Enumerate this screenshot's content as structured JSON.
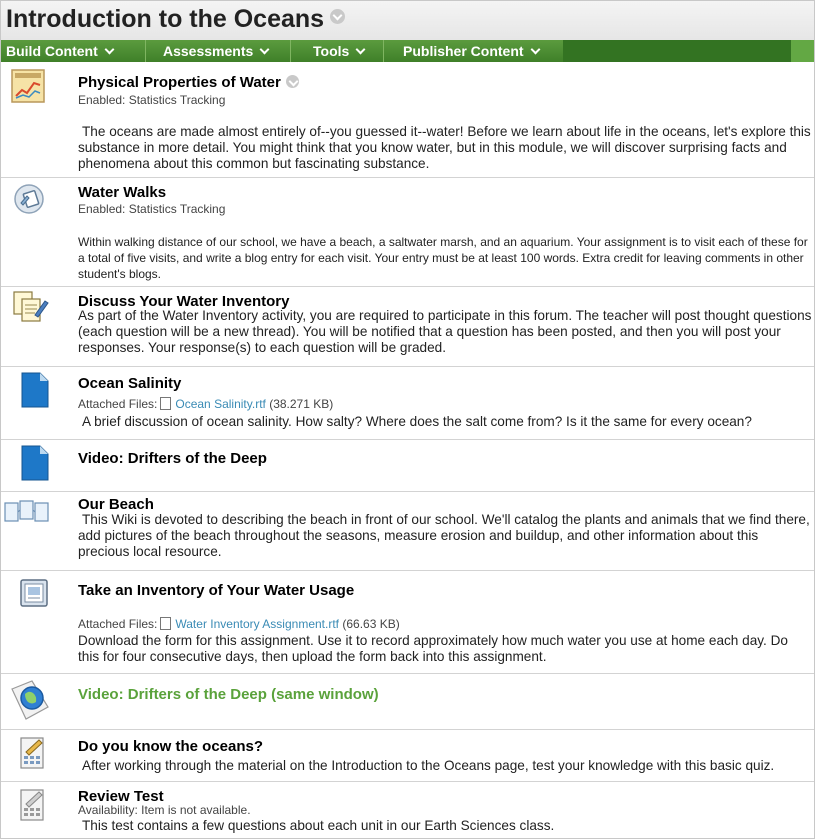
{
  "page": {
    "title": "Introduction to the Oceans"
  },
  "menu": [
    {
      "label": "Build Content"
    },
    {
      "label": "Assessments"
    },
    {
      "label": "Tools"
    },
    {
      "label": "Publisher Content"
    }
  ],
  "items": [
    {
      "icon": "chart-icon",
      "title": "Physical Properties of Water",
      "meta": "Enabled:  Statistics Tracking",
      "description": "The oceans are made almost entirely of--you guessed it--water! Before we learn about life in the oceans, let's explore this substance in more detail. You might think that you know water, but in this module, we will discover surprising facts and phenomena about this common but fascinating substance."
    },
    {
      "icon": "blog-icon",
      "title": "Water Walks",
      "meta": "Enabled:  Statistics Tracking",
      "description": "Within walking distance of our school, we have a beach, a saltwater marsh, and an aquarium. Your assignment is to visit each of these for a total of five visits, and write a blog entry for each visit. Your entry must be at least 100 words. Extra credit for leaving comments in other student's blogs."
    },
    {
      "icon": "discussion-icon",
      "title": "Discuss Your Water Inventory",
      "description": "As part of the Water Inventory activity, you are required to participate in this forum. The teacher will post thought questions (each question will be a new thread). You will be notified that a question has been posted, and then you will post your responses. Your response(s) to each question will be graded."
    },
    {
      "icon": "document-icon",
      "title": "Ocean Salinity",
      "attachment_label": "Attached Files:",
      "file_name": "Ocean Salinity.rtf",
      "file_size": "(38.271 KB)",
      "description": "A brief discussion of ocean salinity. How salty? Where does the salt come from? Is it the same for every ocean?"
    },
    {
      "icon": "document-icon",
      "title": "Video: Drifters of the Deep"
    },
    {
      "icon": "wiki-icon",
      "title": "Our Beach",
      "description": "This Wiki is devoted to describing the beach in front of our school. We'll catalog the plants and animals that we find there, add pictures of the beach throughout the seasons, measure erosion and buildup, and other information about this precious local resource."
    },
    {
      "icon": "assignment-icon",
      "title": "Take an Inventory of Your Water Usage",
      "attachment_label": "Attached Files:",
      "file_name": "Water Inventory Assignment.rtf",
      "file_size": "(66.63 KB)",
      "description": "Download the form for this assignment. Use it to record approximately how much water you use at home each day. Do this for four consecutive days, then upload the form back into this assignment."
    },
    {
      "icon": "web-link-icon",
      "title": "Video: Drifters of the Deep (same window)"
    },
    {
      "icon": "test-icon",
      "title": "Do you know the oceans?",
      "description": "After working through the material on the Introduction to the Oceans page, test your knowledge with this basic quiz."
    },
    {
      "icon": "test-icon",
      "title": "Review Test",
      "meta": "Availability:  Item is not available.",
      "description": "This test contains a few questions about each unit in our Earth Sciences class."
    }
  ]
}
